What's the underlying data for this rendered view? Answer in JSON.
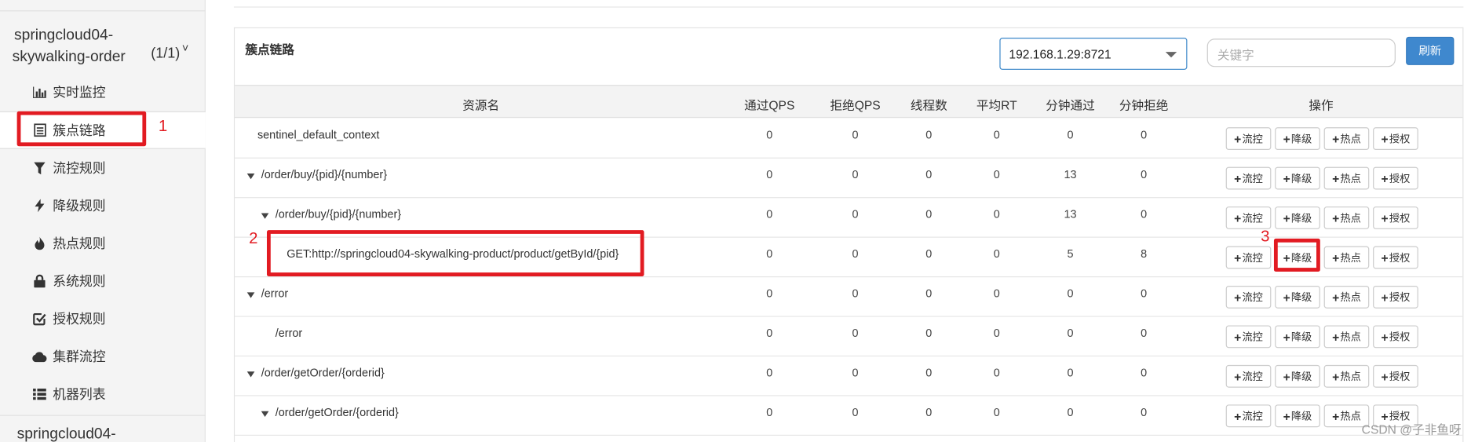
{
  "sidebar": {
    "app_name_line1": "springcloud04-",
    "app_name_line2": "skywalking-order",
    "app_count": "(1/1)",
    "caret": "˅",
    "items": [
      {
        "label": "实时监控",
        "icon": "bar-chart-icon"
      },
      {
        "label": "簇点链路",
        "icon": "list-icon",
        "active": true
      },
      {
        "label": "流控规则",
        "icon": "filter-icon"
      },
      {
        "label": "降级规则",
        "icon": "bolt-icon"
      },
      {
        "label": "热点规则",
        "icon": "fire-icon"
      },
      {
        "label": "系统规则",
        "icon": "lock-icon"
      },
      {
        "label": "授权规则",
        "icon": "check-square-icon"
      },
      {
        "label": "集群流控",
        "icon": "cloud-icon"
      },
      {
        "label": "机器列表",
        "icon": "th-list-icon"
      }
    ],
    "app2_name": "springcloud04-"
  },
  "annotations": {
    "n1": "1",
    "n2": "2",
    "n3": "3"
  },
  "panel": {
    "title": "簇点链路",
    "machine": "192.168.1.29:8721",
    "search_placeholder": "关键字",
    "refresh_label": "刷新"
  },
  "table": {
    "headers": [
      "资源名",
      "通过QPS",
      "拒绝QPS",
      "线程数",
      "平均RT",
      "分钟通过",
      "分钟拒绝",
      "操作"
    ],
    "buttons": [
      "流控",
      "降级",
      "热点",
      "授权"
    ],
    "rows": [
      {
        "name": "sentinel_default_context",
        "level": 0,
        "expand": false,
        "values": [
          "0",
          "0",
          "0",
          "0",
          "0",
          "0"
        ]
      },
      {
        "name": "/order/buy/{pid}/{number}",
        "level": 0,
        "expand": true,
        "values": [
          "0",
          "0",
          "0",
          "0",
          "13",
          "0"
        ]
      },
      {
        "name": "/order/buy/{pid}/{number}",
        "level": 1,
        "expand": true,
        "values": [
          "0",
          "0",
          "0",
          "0",
          "13",
          "0"
        ]
      },
      {
        "name": "GET:http://springcloud04-skywalking-product/product/getById/{pid}",
        "level": 2,
        "expand": false,
        "values": [
          "0",
          "0",
          "0",
          "0",
          "5",
          "8"
        ]
      },
      {
        "name": "/error",
        "level": 0,
        "expand": true,
        "values": [
          "0",
          "0",
          "0",
          "0",
          "0",
          "0"
        ]
      },
      {
        "name": "/error",
        "level": 1,
        "expand": false,
        "values": [
          "0",
          "0",
          "0",
          "0",
          "0",
          "0"
        ]
      },
      {
        "name": "/order/getOrder/{orderid}",
        "level": 0,
        "expand": true,
        "values": [
          "0",
          "0",
          "0",
          "0",
          "0",
          "0"
        ]
      },
      {
        "name": "/order/getOrder/{orderid}",
        "level": 1,
        "expand": true,
        "values": [
          "0",
          "0",
          "0",
          "0",
          "0",
          "0"
        ]
      }
    ]
  },
  "watermark": "CSDN @子非鱼呀"
}
